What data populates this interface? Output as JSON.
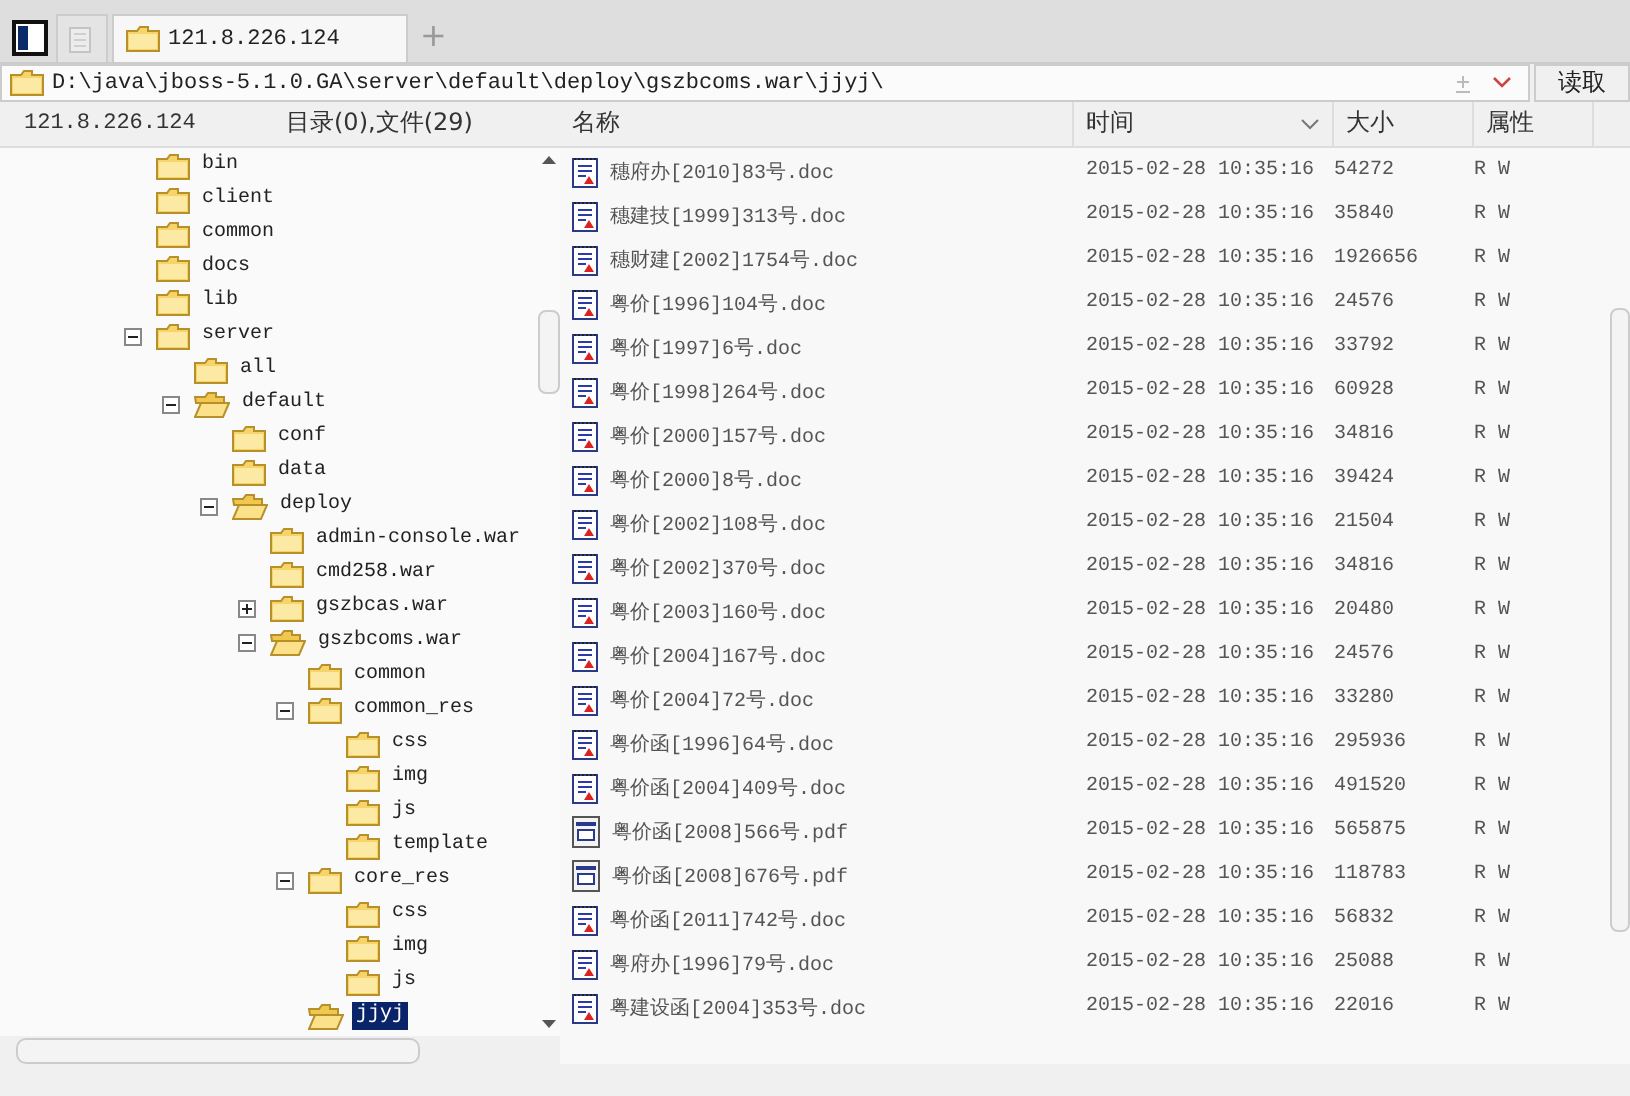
{
  "tabs": [
    {
      "kind": "panel",
      "selected": false
    },
    {
      "kind": "blank",
      "selected": false
    },
    {
      "kind": "folder",
      "label": "121.8.226.124",
      "selected": true
    }
  ],
  "new_tab": "+",
  "address": {
    "value": "D:\\java\\jboss-5.1.0.GA\\server\\default\\deploy\\gszbcoms.war\\jjyj\\",
    "button": "读取"
  },
  "tree_header": {
    "host": "121.8.226.124",
    "summary": "目录(0),文件(29)"
  },
  "tree": [
    {
      "label": "bin",
      "selected": false
    },
    {
      "label": "client",
      "selected": false
    },
    {
      "label": "common",
      "selected": false
    },
    {
      "label": "docs",
      "selected": false
    },
    {
      "label": "lib",
      "selected": false
    },
    {
      "label": "server",
      "selected": false,
      "expanded": true,
      "children": [
        {
          "label": "all",
          "selected": false
        },
        {
          "label": "default",
          "selected": false,
          "expanded": true,
          "open": true,
          "children": [
            {
              "label": "conf",
              "selected": false
            },
            {
              "label": "data",
              "selected": false
            },
            {
              "label": "deploy",
              "selected": false,
              "expanded": true,
              "open": true,
              "children": [
                {
                  "label": "admin-console.war",
                  "selected": false
                },
                {
                  "label": "cmd258.war",
                  "selected": false
                },
                {
                  "label": "gszbcas.war",
                  "selected": false,
                  "expanded": false
                },
                {
                  "label": "gszbcoms.war",
                  "selected": false,
                  "expanded": true,
                  "open": true,
                  "children": [
                    {
                      "label": "common",
                      "selected": false
                    },
                    {
                      "label": "common_res",
                      "selected": false,
                      "expanded": true,
                      "children": [
                        {
                          "label": "css",
                          "selected": false
                        },
                        {
                          "label": "img",
                          "selected": false
                        },
                        {
                          "label": "js",
                          "selected": false
                        },
                        {
                          "label": "template",
                          "selected": false
                        }
                      ]
                    },
                    {
                      "label": "core_res",
                      "selected": false,
                      "expanded": true,
                      "children": [
                        {
                          "label": "css",
                          "selected": false
                        },
                        {
                          "label": "img",
                          "selected": false
                        },
                        {
                          "label": "js",
                          "selected": false
                        }
                      ]
                    },
                    {
                      "label": "jjyj",
                      "selected": true,
                      "open": true
                    }
                  ]
                }
              ]
            }
          ]
        }
      ]
    }
  ],
  "columns": [
    {
      "label": "名称"
    },
    {
      "label": "时间",
      "sorted": true
    },
    {
      "label": "大小"
    },
    {
      "label": "属性"
    }
  ],
  "files": [
    {
      "kind": "doc",
      "name": "穗府办[2010]83号.doc",
      "time": "2015-02-28 10:35:16",
      "size": "54272",
      "attr": "R W"
    },
    {
      "kind": "doc",
      "name": "穗建技[1999]313号.doc",
      "time": "2015-02-28 10:35:16",
      "size": "35840",
      "attr": "R W"
    },
    {
      "kind": "doc",
      "name": "穗财建[2002]1754号.doc",
      "time": "2015-02-28 10:35:16",
      "size": "1926656",
      "attr": "R W"
    },
    {
      "kind": "doc",
      "name": "粤价[1996]104号.doc",
      "time": "2015-02-28 10:35:16",
      "size": "24576",
      "attr": "R W"
    },
    {
      "kind": "doc",
      "name": "粤价[1997]6号.doc",
      "time": "2015-02-28 10:35:16",
      "size": "33792",
      "attr": "R W"
    },
    {
      "kind": "doc",
      "name": "粤价[1998]264号.doc",
      "time": "2015-02-28 10:35:16",
      "size": "60928",
      "attr": "R W"
    },
    {
      "kind": "doc",
      "name": "粤价[2000]157号.doc",
      "time": "2015-02-28 10:35:16",
      "size": "34816",
      "attr": "R W"
    },
    {
      "kind": "doc",
      "name": "粤价[2000]8号.doc",
      "time": "2015-02-28 10:35:16",
      "size": "39424",
      "attr": "R W"
    },
    {
      "kind": "doc",
      "name": "粤价[2002]108号.doc",
      "time": "2015-02-28 10:35:16",
      "size": "21504",
      "attr": "R W"
    },
    {
      "kind": "doc",
      "name": "粤价[2002]370号.doc",
      "time": "2015-02-28 10:35:16",
      "size": "34816",
      "attr": "R W"
    },
    {
      "kind": "doc",
      "name": "粤价[2003]160号.doc",
      "time": "2015-02-28 10:35:16",
      "size": "20480",
      "attr": "R W"
    },
    {
      "kind": "doc",
      "name": "粤价[2004]167号.doc",
      "time": "2015-02-28 10:35:16",
      "size": "24576",
      "attr": "R W"
    },
    {
      "kind": "doc",
      "name": "粤价[2004]72号.doc",
      "time": "2015-02-28 10:35:16",
      "size": "33280",
      "attr": "R W"
    },
    {
      "kind": "doc",
      "name": "粤价函[1996]64号.doc",
      "time": "2015-02-28 10:35:16",
      "size": "295936",
      "attr": "R W"
    },
    {
      "kind": "doc",
      "name": "粤价函[2004]409号.doc",
      "time": "2015-02-28 10:35:16",
      "size": "491520",
      "attr": "R W"
    },
    {
      "kind": "pdf",
      "name": "粤价函[2008]566号.pdf",
      "time": "2015-02-28 10:35:16",
      "size": "565875",
      "attr": "R W"
    },
    {
      "kind": "pdf",
      "name": "粤价函[2008]676号.pdf",
      "time": "2015-02-28 10:35:16",
      "size": "118783",
      "attr": "R W"
    },
    {
      "kind": "doc",
      "name": "粤价函[2011]742号.doc",
      "time": "2015-02-28 10:35:16",
      "size": "56832",
      "attr": "R W"
    },
    {
      "kind": "doc",
      "name": "粤府办[1996]79号.doc",
      "time": "2015-02-28 10:35:16",
      "size": "25088",
      "attr": "R W"
    },
    {
      "kind": "doc",
      "name": "粤建设函[2004]353号.doc",
      "time": "2015-02-28 10:35:16",
      "size": "22016",
      "attr": "R W"
    }
  ]
}
